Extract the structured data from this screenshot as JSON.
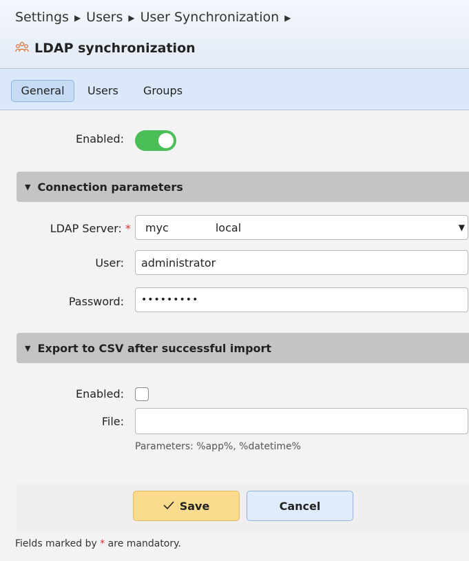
{
  "breadcrumb": {
    "items": [
      "Settings",
      "Users",
      "User Synchronization"
    ]
  },
  "page": {
    "title": "LDAP synchronization",
    "icon": "users-icon"
  },
  "tabs": [
    {
      "label": "General",
      "active": true
    },
    {
      "label": "Users",
      "active": false
    },
    {
      "label": "Groups",
      "active": false
    }
  ],
  "general": {
    "enabled_label": "Enabled:",
    "enabled": true
  },
  "connection": {
    "section_title": "Connection parameters",
    "server_label": "LDAP Server:",
    "server_value_prefix": "myc",
    "server_value_suffix": "local",
    "user_label": "User:",
    "user_value": "administrator",
    "password_label": "Password:",
    "password_value": "•••••••••"
  },
  "export": {
    "section_title": "Export to CSV after successful import",
    "enabled_label": "Enabled:",
    "enabled": false,
    "file_label": "File:",
    "file_value": "",
    "hint": "Parameters: %app%, %datetime%"
  },
  "actions": {
    "save_label": "Save",
    "cancel_label": "Cancel"
  },
  "footer": {
    "note_prefix": "Fields marked by",
    "required_mark": "*",
    "note_suffix": "are mandatory."
  },
  "colors": {
    "toggle_on": "#4cbe57",
    "save_button": "#fbdc8e",
    "cancel_button": "#e1ecfb",
    "section_bar": "#c4c4c4",
    "required": "#d33"
  }
}
